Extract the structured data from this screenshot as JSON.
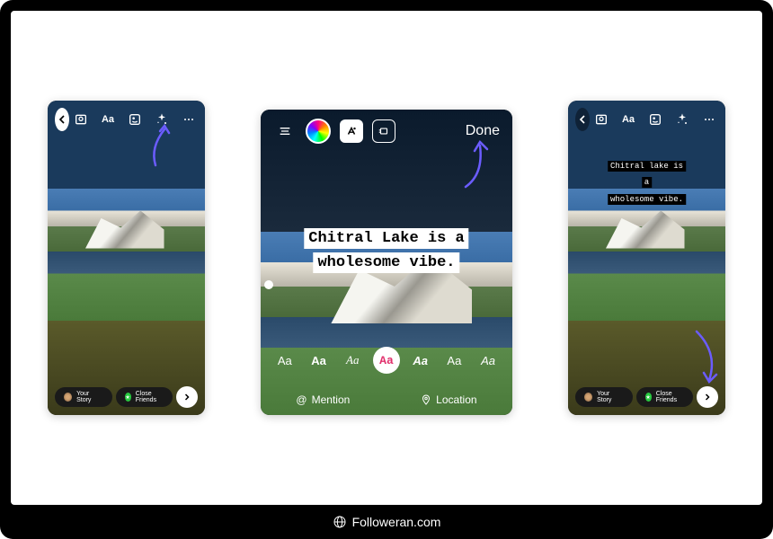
{
  "footer": {
    "site": "Followeran.com"
  },
  "screen1": {
    "bottom": {
      "your_story": "Your Story",
      "close_friends": "Close Friends"
    }
  },
  "screen2": {
    "done": "Done",
    "caption_line1": "Chitral Lake is a",
    "caption_line2": "wholesome vibe.",
    "fonts": [
      "Aa",
      "Aa",
      "Aa",
      "Aa",
      "Aa",
      "Aa",
      "Aa"
    ],
    "mention": "Mention",
    "location": "Location"
  },
  "screen3": {
    "caption_line1": "Chitral lake is a",
    "caption_line2": "wholesome vibe.",
    "bottom": {
      "your_story": "Your Story",
      "close_friends": "Close Friends"
    }
  }
}
